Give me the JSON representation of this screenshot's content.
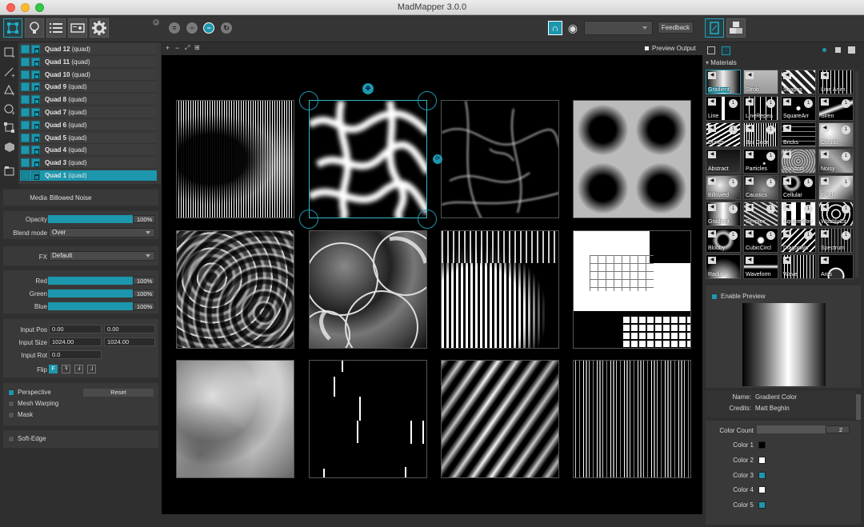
{
  "window": {
    "title": "MadMapper 3.0.0"
  },
  "toolbar": {
    "feedback_label": "Feedback",
    "preview_output_label": "Preview Output"
  },
  "layers": [
    {
      "name": "Quad 12",
      "type": "(quad)",
      "selected": false
    },
    {
      "name": "Quad 11",
      "type": "(quad)",
      "selected": false
    },
    {
      "name": "Quad 10",
      "type": "(quad)",
      "selected": false
    },
    {
      "name": "Quad 9",
      "type": "(quad)",
      "selected": false
    },
    {
      "name": "Quad 8",
      "type": "(quad)",
      "selected": false
    },
    {
      "name": "Quad 7",
      "type": "(quad)",
      "selected": false
    },
    {
      "name": "Quad 6",
      "type": "(quad)",
      "selected": false
    },
    {
      "name": "Quad 5",
      "type": "(quad)",
      "selected": false
    },
    {
      "name": "Quad 4",
      "type": "(quad)",
      "selected": false
    },
    {
      "name": "Quad 3",
      "type": "(quad)",
      "selected": false
    },
    {
      "name": "Quad 1",
      "type": "(quad)",
      "selected": true
    }
  ],
  "properties": {
    "media_label": "Media",
    "media_value": "Billowed Noise",
    "opacity_label": "Opacity",
    "opacity_value": "100%",
    "blend_label": "Blend mode",
    "blend_value": "Over",
    "fx_label": "FX",
    "fx_value": "Default",
    "red_label": "Red",
    "red_value": "100%",
    "green_label": "Green",
    "green_value": "100%",
    "blue_label": "Blue",
    "blue_value": "100%",
    "input_pos_label": "Input Pos",
    "input_pos_x": "0.00",
    "input_pos_y": "0.00",
    "input_size_label": "Input Size",
    "input_size_w": "1024.00",
    "input_size_h": "1024.00",
    "input_rot_label": "Input Rot",
    "input_rot_value": "0.0",
    "flip_label": "Flip",
    "flip_buttons": [
      "F",
      "ꟻ",
      "Ⅎ",
      "⅃"
    ],
    "perspective_label": "Perspective",
    "reset_label": "Reset",
    "mesh_warping_label": "Mesh Warping",
    "mask_label": "Mask",
    "soft_edge_label": "Soft-Edge"
  },
  "materials": {
    "header": "Materials",
    "items": [
      {
        "label": "Gradient",
        "selected": true
      },
      {
        "label": "Strob"
      },
      {
        "label": "Shapes"
      },
      {
        "label": "Line Anim"
      },
      {
        "label": "Line",
        "badge": "1"
      },
      {
        "label": "LineRepea",
        "badge": "1"
      },
      {
        "label": "SquareArr",
        "badge": "1"
      },
      {
        "label": "Siren",
        "badge": "1"
      },
      {
        "label": "Dunes",
        "badge": "1"
      },
      {
        "label": "Bar Code",
        "badge": "1"
      },
      {
        "label": "Bricks"
      },
      {
        "label": "Clouds",
        "badge": "1"
      },
      {
        "label": "Abstract"
      },
      {
        "label": "Particles",
        "badge": "1"
      },
      {
        "label": "Random"
      },
      {
        "label": "Noisy",
        "badge": "1"
      },
      {
        "label": "Billowed",
        "badge": "1"
      },
      {
        "label": "Caustics",
        "badge": "1"
      },
      {
        "label": "Cellular",
        "badge": "1"
      },
      {
        "label": "Fluid",
        "badge": "1"
      },
      {
        "label": "Gradient",
        "badge": "1"
      },
      {
        "label": "Simplex",
        "badge": "1"
      },
      {
        "label": "SquareWav",
        "badge": "1"
      },
      {
        "label": "WobblyCir",
        "badge": "1"
      },
      {
        "label": "Blobby",
        "badge": "1"
      },
      {
        "label": "CubicCircl",
        "badge": "1"
      },
      {
        "label": "Diagonals",
        "badge": "1"
      },
      {
        "label": "Spectrum",
        "badge": "1"
      },
      {
        "label": "Radial"
      },
      {
        "label": "Waveform"
      },
      {
        "label": "Wave"
      },
      {
        "label": "Arcs"
      }
    ]
  },
  "preview": {
    "enable_label": "Enable Preview",
    "name_label": "Name:",
    "name_value": "Gradient Color",
    "credits_label": "Credits:",
    "credits_value": "Matt Beghin"
  },
  "material_params": {
    "color_count_label": "Color Count",
    "color_count_value": "2",
    "colors": [
      {
        "label": "Color 1",
        "color": "#000000"
      },
      {
        "label": "Color 2",
        "color": "#ffffff"
      },
      {
        "label": "Color 3",
        "color": "#1d97ad"
      },
      {
        "label": "Color 4",
        "color": "#ffffff"
      },
      {
        "label": "Color 5",
        "color": "#1d97ad"
      }
    ]
  },
  "accent_color": "#1d97ad"
}
